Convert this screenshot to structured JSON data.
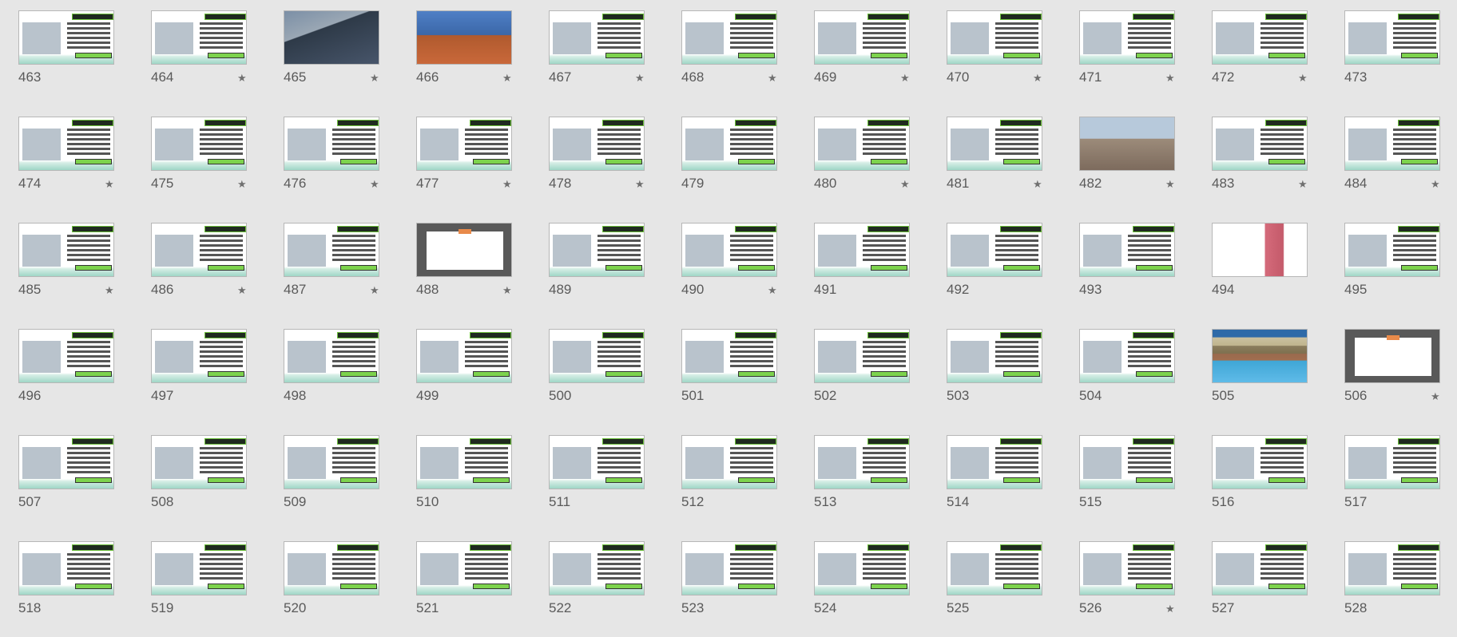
{
  "slides": [
    {
      "number": "463",
      "starred": false
    },
    {
      "number": "464",
      "starred": true
    },
    {
      "number": "465",
      "starred": true
    },
    {
      "number": "466",
      "starred": true
    },
    {
      "number": "467",
      "starred": true
    },
    {
      "number": "468",
      "starred": true
    },
    {
      "number": "469",
      "starred": true
    },
    {
      "number": "470",
      "starred": true
    },
    {
      "number": "471",
      "starred": true
    },
    {
      "number": "472",
      "starred": true
    },
    {
      "number": "473",
      "starred": false
    },
    {
      "number": "474",
      "starred": true
    },
    {
      "number": "475",
      "starred": true
    },
    {
      "number": "476",
      "starred": true
    },
    {
      "number": "477",
      "starred": true
    },
    {
      "number": "478",
      "starred": true
    },
    {
      "number": "479",
      "starred": false
    },
    {
      "number": "480",
      "starred": true
    },
    {
      "number": "481",
      "starred": true
    },
    {
      "number": "482",
      "starred": true
    },
    {
      "number": "483",
      "starred": true
    },
    {
      "number": "484",
      "starred": true
    },
    {
      "number": "485",
      "starred": true
    },
    {
      "number": "486",
      "starred": true
    },
    {
      "number": "487",
      "starred": true
    },
    {
      "number": "488",
      "starred": true
    },
    {
      "number": "489",
      "starred": false
    },
    {
      "number": "490",
      "starred": true
    },
    {
      "number": "491",
      "starred": false
    },
    {
      "number": "492",
      "starred": false
    },
    {
      "number": "493",
      "starred": false
    },
    {
      "number": "494",
      "starred": false
    },
    {
      "number": "495",
      "starred": false
    },
    {
      "number": "496",
      "starred": false
    },
    {
      "number": "497",
      "starred": false
    },
    {
      "number": "498",
      "starred": false
    },
    {
      "number": "499",
      "starred": false
    },
    {
      "number": "500",
      "starred": false
    },
    {
      "number": "501",
      "starred": false
    },
    {
      "number": "502",
      "starred": false
    },
    {
      "number": "503",
      "starred": false
    },
    {
      "number": "504",
      "starred": false
    },
    {
      "number": "505",
      "starred": false
    },
    {
      "number": "506",
      "starred": true
    },
    {
      "number": "507",
      "starred": false
    },
    {
      "number": "508",
      "starred": false
    },
    {
      "number": "509",
      "starred": false
    },
    {
      "number": "510",
      "starred": false
    },
    {
      "number": "511",
      "starred": false
    },
    {
      "number": "512",
      "starred": false
    },
    {
      "number": "513",
      "starred": false
    },
    {
      "number": "514",
      "starred": false
    },
    {
      "number": "515",
      "starred": false
    },
    {
      "number": "516",
      "starred": false
    },
    {
      "number": "517",
      "starred": false
    },
    {
      "number": "518",
      "starred": false
    },
    {
      "number": "519",
      "starred": false
    },
    {
      "number": "520",
      "starred": false
    },
    {
      "number": "521",
      "starred": false
    },
    {
      "number": "522",
      "starred": false
    },
    {
      "number": "523",
      "starred": false
    },
    {
      "number": "524",
      "starred": false
    },
    {
      "number": "525",
      "starred": false
    },
    {
      "number": "526",
      "starred": true
    },
    {
      "number": "527",
      "starred": false
    },
    {
      "number": "528",
      "starred": false
    }
  ],
  "star_icon": "★",
  "thumb_styles": {
    "465": "photo1",
    "466": "photo2",
    "482": "city",
    "488": "dark",
    "494": "wall",
    "505": "bands",
    "506": "dark"
  }
}
